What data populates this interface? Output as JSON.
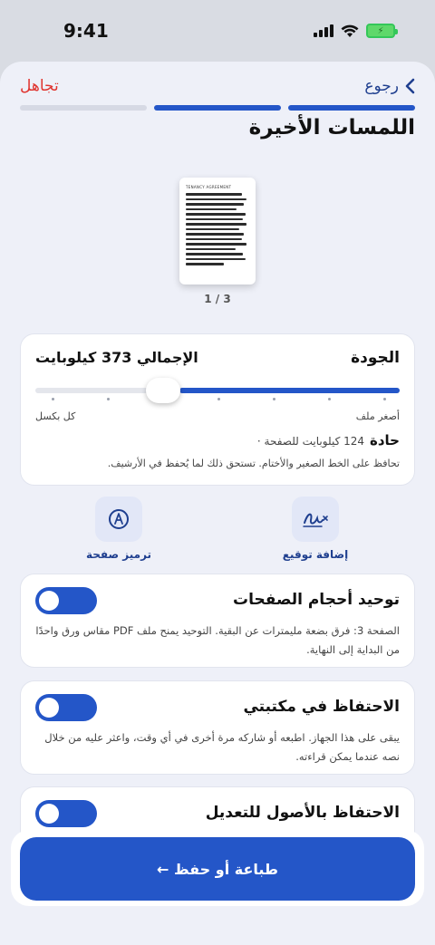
{
  "status": {
    "time": "9:41"
  },
  "nav": {
    "dismiss": "تجاهل",
    "back": "رجوع"
  },
  "progress": {
    "steps_total": 3,
    "steps_done": 2
  },
  "title": "اللمسات الأخيرة",
  "preview": {
    "doc_heading": "TENANCY AGREEMENT",
    "page_counter": "1 / 3"
  },
  "quality": {
    "label": "الجودة",
    "total": "الإجمالي 373 كيلوبايت",
    "slider_value": 0.4,
    "min_label": "أصغر ملف",
    "max_label": "كل بكسل",
    "level_name": "حادة",
    "level_size": "124 كيلوبايت للصفحة ·",
    "level_desc": "تحافظ على الخط الصغير والأختام. تستحق ذلك لما يُحفظ في الأرشيف."
  },
  "actions": {
    "add_signature": "إضافة توقيع",
    "page_code": "ترميز صفحة"
  },
  "toggles": [
    {
      "title": "توحيد أحجام الصفحات",
      "desc": "الصفحة 3: فرق بضعة مليمترات عن البقية. التوحيد يمنح ملف PDF مقاس ورق واحدًا من البداية إلى النهاية.",
      "on": true
    },
    {
      "title": "الاحتفاظ في مكتبتي",
      "desc": "يبقى على هذا الجهاز. اطبعه أو شاركه مرة أخرى في أي وقت، واعثر عليه من خلال نصه عندما يمكن قراءته.",
      "on": true
    },
    {
      "title": "الاحتفاظ بالأصول للتعديل",
      "desc": "",
      "on": true
    }
  ],
  "primary_button": "طباعة أو حفظ ←",
  "colors": {
    "accent": "#2456c8",
    "danger": "#e0342f",
    "background": "#eef0f8"
  }
}
